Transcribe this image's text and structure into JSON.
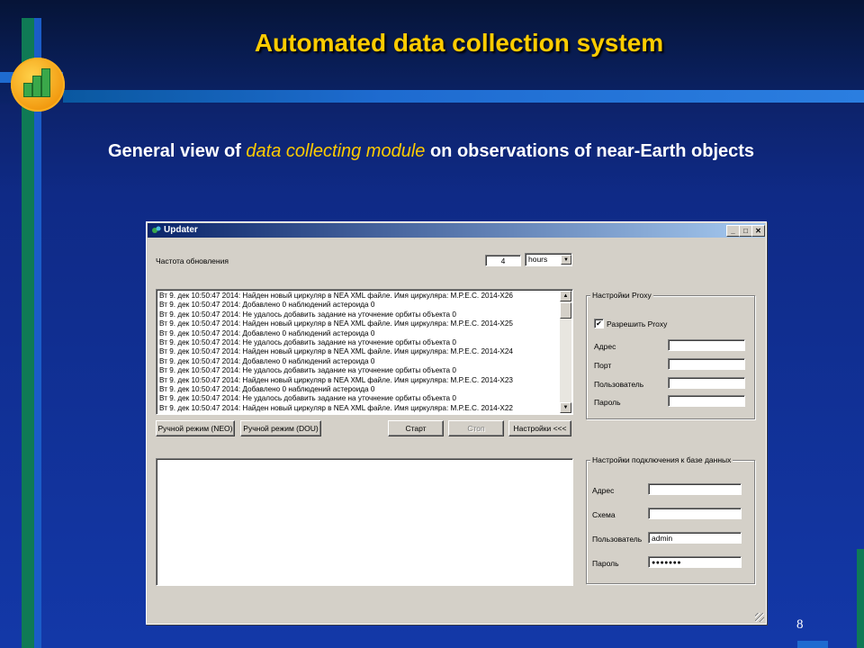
{
  "slide": {
    "title": "Automated data collection system",
    "subtitle_pre": "General view of ",
    "subtitle_highlight": "data collecting module",
    "subtitle_post": " on observations of near-Earth objects",
    "page_number": "8",
    "colors": {
      "accent": "#ffcc00",
      "background": "#1338a8"
    }
  },
  "window": {
    "title": "Updater",
    "controls": {
      "minimize": "_",
      "maximize": "□",
      "close": "✕"
    },
    "frequency": {
      "label": "Частота обновления",
      "value": "4",
      "unit": "hours"
    },
    "log_lines": [
      "Вт 9. дек 10:50:47 2014: Найден новый циркуляр в NEA XML файле. Имя циркуляра: M.P.E.C. 2014-X26",
      "Вт 9. дек 10:50:47 2014: Добавлено 0 наблюдений астероида 0",
      "Вт 9. дек 10:50:47 2014: Не удалось добавить задание на уточнение орбиты объекта 0",
      "Вт 9. дек 10:50:47 2014: Найден новый циркуляр в NEA XML файле. Имя циркуляра: M.P.E.C. 2014-X25",
      "Вт 9. дек 10:50:47 2014: Добавлено 0 наблюдений астероида 0",
      "Вт 9. дек 10:50:47 2014: Не удалось добавить задание на уточнение орбиты объекта 0",
      "Вт 9. дек 10:50:47 2014: Найден новый циркуляр в NEA XML файле. Имя циркуляра: M.P.E.C. 2014-X24",
      "Вт 9. дек 10:50:47 2014: Добавлено 0 наблюдений астероида 0",
      "Вт 9. дек 10:50:47 2014: Не удалось добавить задание на уточнение орбиты объекта 0",
      "Вт 9. дек 10:50:47 2014: Найден новый циркуляр в NEA XML файле. Имя циркуляра: M.P.E.C. 2014-X23",
      "Вт 9. дек 10:50:47 2014: Добавлено 0 наблюдений астероида 0",
      "Вт 9. дек 10:50:47 2014: Не удалось добавить задание на уточнение орбиты объекта 0",
      "Вт 9. дек 10:50:47 2014: Найден новый циркуляр в NEA XML файле. Имя циркуляра: M.P.E.C. 2014-X22"
    ],
    "buttons": {
      "manual_neo": "Ручной режим (NEO)",
      "manual_dou": "Ручной режим (DOU)",
      "start": "Старт",
      "stop": "Стоп",
      "settings": "Настройки <<<"
    },
    "proxy": {
      "group_label": "Настройки Proxy",
      "enable_label": "Разрешить Proxy",
      "enabled": true,
      "address_label": "Адрес",
      "address_value": "",
      "port_label": "Порт",
      "port_value": "",
      "user_label": "Пользователь",
      "user_value": "",
      "password_label": "Пароль",
      "password_value": ""
    },
    "database": {
      "group_label": "Настройки подключения к базе данных",
      "address_label": "Адрес",
      "address_value": "",
      "schema_label": "Схема",
      "schema_value": "",
      "user_label": "Пользователь",
      "user_value": "admin",
      "password_label": "Пароль",
      "password_value": "●●●●●●●"
    }
  }
}
